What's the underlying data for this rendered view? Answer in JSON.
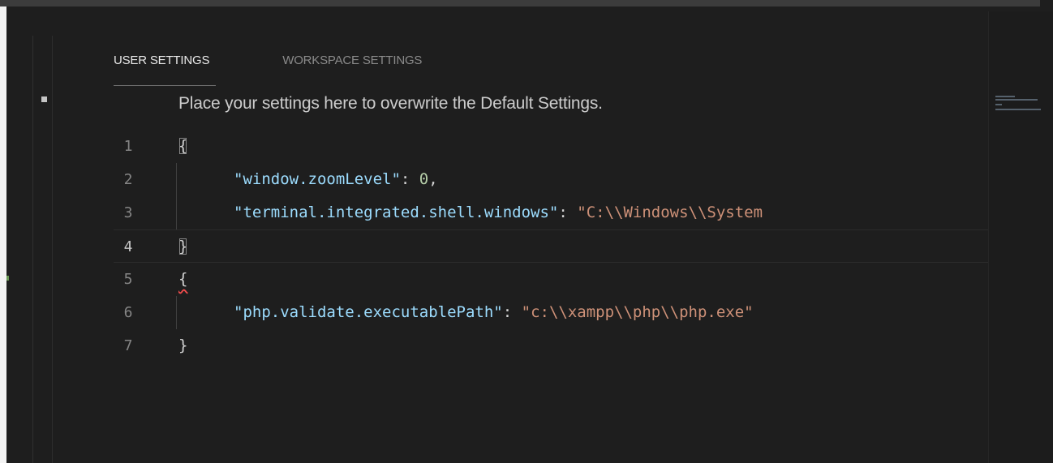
{
  "tabs": [
    {
      "label": "USER SETTINGS",
      "active": true
    },
    {
      "label": "WORKSPACE SETTINGS",
      "active": false
    }
  ],
  "hint": "Place your settings here to overwrite the Default Settings.",
  "code": {
    "current_line": 4,
    "lines": [
      {
        "number": "1",
        "text": "{"
      },
      {
        "number": "2",
        "key": "\"window.zoomLevel\"",
        "sep": ": ",
        "value": "0",
        "tail": ","
      },
      {
        "number": "3",
        "key": "\"terminal.integrated.shell.windows\"",
        "sep": ": ",
        "value": "\"C:\\\\Windows\\\\System"
      },
      {
        "number": "4",
        "text": "}"
      },
      {
        "number": "5",
        "text": "{"
      },
      {
        "number": "6",
        "key": "\"php.validate.executablePath\"",
        "sep": ": ",
        "value": "\"c:\\\\xampp\\\\php\\\\php.exe\""
      },
      {
        "number": "7",
        "text": "}"
      }
    ]
  },
  "colors": {
    "background": "#1e1e1e",
    "key": "#9cdcfe",
    "string": "#ce9178",
    "number": "#b5cea8"
  }
}
